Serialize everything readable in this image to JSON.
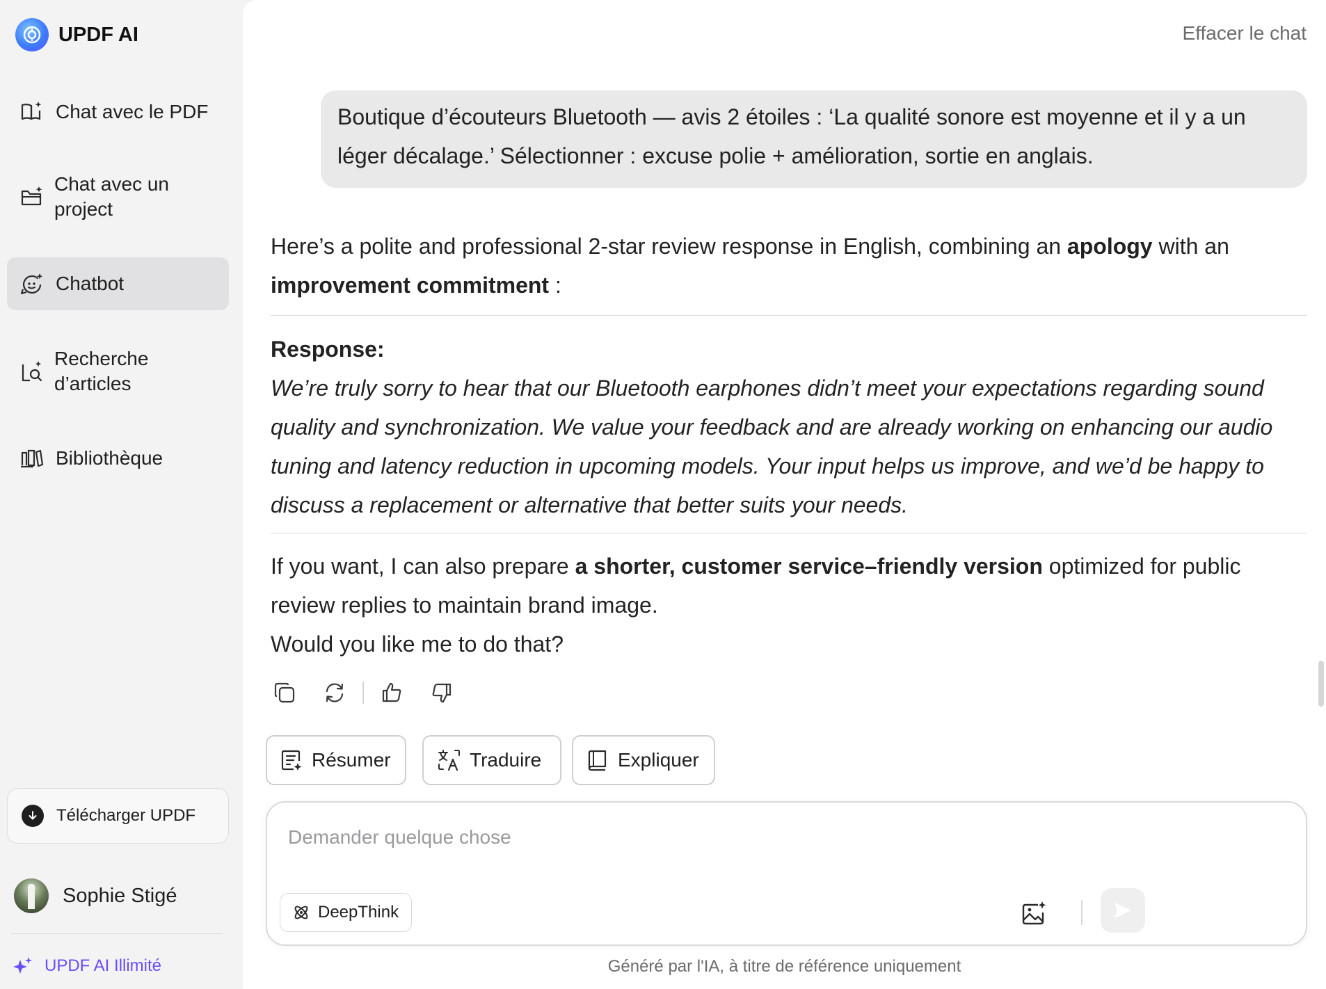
{
  "app": {
    "title": "UPDF AI"
  },
  "sidebar": {
    "items": [
      {
        "label": "Chat avec le PDF",
        "icon": "book-sparkle-icon"
      },
      {
        "label": "Chat avec un project",
        "icon": "folder-sparkle-icon"
      },
      {
        "label": "Chatbot",
        "icon": "chatbot-icon",
        "active": true
      },
      {
        "label": "Recherche d’articles",
        "icon": "search-document-icon"
      },
      {
        "label": "Bibliothèque",
        "icon": "library-icon"
      }
    ],
    "download_label": "Télécharger UPDF",
    "user_name": "Sophie Stigé",
    "unlimited_label": "UPDF AI Illimité"
  },
  "header": {
    "clear_chat": "Effacer le chat"
  },
  "conversation": {
    "user_message": "Boutique d’écouteurs Bluetooth — avis 2 étoiles : ‘La qualité sonore est moyenne et il y a un léger décalage.’ Sélectionner : excuse polie + amélioration, sortie en anglais.",
    "answer": {
      "intro_before": "Here’s a polite and professional 2-star review response in English, combining an ",
      "intro_bold_1": "apology",
      "intro_between": " with an ",
      "intro_bold_2": "improvement commitment",
      "intro_after": " :",
      "response_title": "Response:",
      "response_body": "We’re truly sorry to hear that our Bluetooth earphones didn’t meet your expectations regarding sound quality and synchronization. We value your feedback and are already working on enhancing our audio tuning and latency reduction in upcoming models. Your input helps us improve, and we’d be happy to discuss a replacement or alternative that better suits your needs.",
      "outro_before": "If you want, I can also prepare ",
      "outro_bold": "a shorter, customer service–friendly version",
      "outro_after": " optimized for public review replies to maintain brand image.",
      "outro_question": "Would you like me to do that?"
    }
  },
  "quick_actions": {
    "summarize": "Résumer",
    "translate": "Traduire",
    "explain": "Expliquer"
  },
  "input": {
    "placeholder": "Demander quelque chose",
    "value": "",
    "deepthink_label": "DeepThink"
  },
  "footer": {
    "note": "Généré par l'IA, à titre de référence uniquement"
  },
  "colors": {
    "accent": "#6b4cf6",
    "sidebar_bg": "#f3f3f4",
    "active_item_bg": "#e1e1e3",
    "bubble_bg": "#e9e9ea"
  }
}
